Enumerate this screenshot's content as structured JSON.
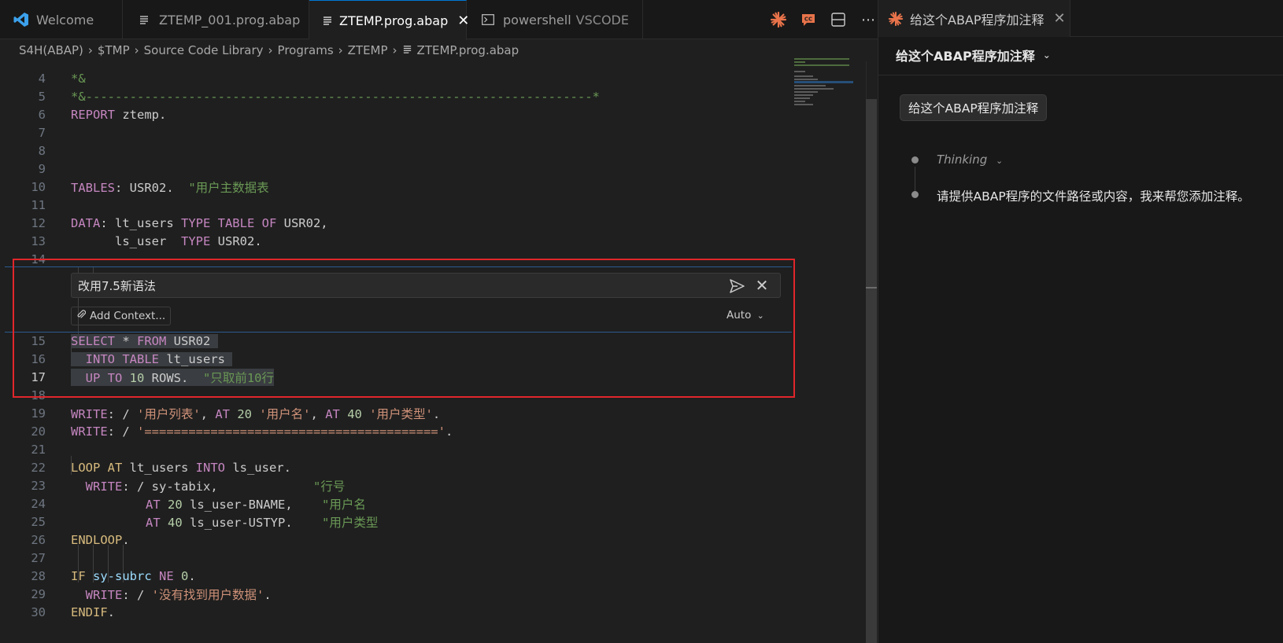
{
  "tabs": [
    {
      "label": "Welcome",
      "icon": "vscode-logo-icon"
    },
    {
      "label": "ZTEMP_001.prog.abap",
      "icon": "file-lines-icon"
    },
    {
      "label": "ZTEMP.prog.abap",
      "icon": "file-lines-icon",
      "active": true
    },
    {
      "label": "powershell",
      "suffix": "VSCODE",
      "icon": "terminal-icon"
    }
  ],
  "breadcrumb": [
    "S4H(ABAP)",
    "$TMP",
    "Source Code Library",
    "Programs",
    "ZTEMP",
    "ZTEMP.prog.abap"
  ],
  "code": {
    "line_numbers": [
      "4",
      "5",
      "6",
      "7",
      "8",
      "9",
      "10",
      "11",
      "12",
      "13",
      "14",
      "15",
      "16",
      "17",
      "18",
      "19",
      "20",
      "21",
      "22",
      "23",
      "24",
      "25",
      "26",
      "27",
      "28",
      "29",
      "30"
    ],
    "current_line": "17",
    "l4": "*&",
    "l5": "*&---------------------------------------------------------------------*",
    "l6_kw": "REPORT",
    "l6_rest": " ztemp.",
    "l10_kw": "TABLES",
    "l10_rest": ": USR02.  ",
    "l10_cmt": "\"用户主数据表",
    "l12_kw": "DATA",
    "l12_a": ": lt_users ",
    "l12_kw2": "TYPE TABLE OF",
    "l12_b": " USR02,",
    "l13_a": "ls_user  ",
    "l13_kw": "TYPE",
    "l13_b": " USR02.",
    "l15_kw1": "SELECT",
    "l15_a": " * ",
    "l15_kw2": "FROM",
    "l15_b": " USR02",
    "l16_kw": "INTO TABLE",
    "l16_a": " lt_users",
    "l17_kw": "UP TO",
    "l17_num": " 10",
    "l17_a": " ROWS.  ",
    "l17_cmt": "\"只取前10行",
    "l19_kw": "WRITE",
    "l19_a": ": / ",
    "l19_s1": "'用户列表'",
    "l19_b": ", ",
    "l19_at1": "AT",
    "l19_n1": " 20 ",
    "l19_s2": "'用户名'",
    "l19_c": ", ",
    "l19_at2": "AT",
    "l19_n2": " 40 ",
    "l19_s3": "'用户类型'",
    "l19_d": ".",
    "l20_kw": "WRITE",
    "l20_a": ": / ",
    "l20_s": "'========================================'",
    "l20_b": ".",
    "l22_kw": "LOOP AT",
    "l22_a": " lt_users ",
    "l22_kw2": "INTO",
    "l22_b": " ls_user.",
    "l23_kw": "WRITE",
    "l23_a": ": / sy-tabix,             ",
    "l23_cmt": "\"行号",
    "l24_at": "AT",
    "l24_n": " 20",
    "l24_a": " ls_user-BNAME,    ",
    "l24_cmt": "\"用户名",
    "l25_at": "AT",
    "l25_n": " 40",
    "l25_a": " ls_user-USTYP.    ",
    "l25_cmt": "\"用户类型",
    "l26_kw": "ENDLOOP",
    "l26_a": ".",
    "l28_kw": "IF",
    "l28_var": " sy-subrc",
    "l28_kw2": " NE",
    "l28_n": " 0",
    "l28_a": ".",
    "l29_kw": "WRITE",
    "l29_a": ": / ",
    "l29_s": "'没有找到用户数据'",
    "l29_b": ".",
    "l30_kw": "ENDIF",
    "l30_a": "."
  },
  "inline_chat": {
    "input_value": "改用7.5新语法",
    "add_context_label": "Add Context...",
    "mode_label": "Auto"
  },
  "chat_panel": {
    "tab_title": "给这个ABAP程序加注释",
    "header_title": "给这个ABAP程序加注释",
    "user_message": "给这个ABAP程序加注释",
    "thinking_label": "Thinking",
    "reply": "请提供ABAP程序的文件路径或内容，我来帮您添加注释。"
  },
  "colors": {
    "accent": "#0078d4",
    "highlight_box": "#e0262b",
    "keyword": "#c586c0",
    "comment": "#6a9955",
    "string": "#ce9178",
    "number": "#b5cea8",
    "claude_orange": "#e8734a"
  }
}
